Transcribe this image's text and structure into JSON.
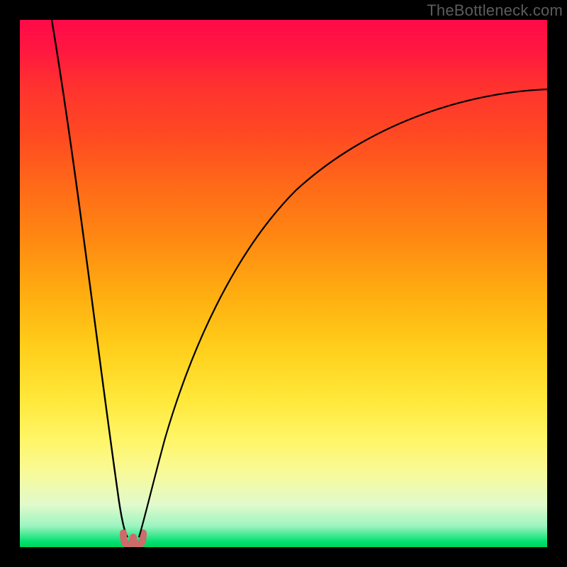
{
  "watermark": {
    "text": "TheBottleneck.com"
  },
  "colors": {
    "frame_border": "#000000",
    "curve": "#000000",
    "notch": "#cf6a6a"
  },
  "chart_data": {
    "type": "line",
    "title": "",
    "xlabel": "",
    "ylabel": "",
    "xlim": [
      0,
      100
    ],
    "ylim": [
      0,
      100
    ],
    "notch_x_pct": 20,
    "notch_width_pct": 4,
    "series": [
      {
        "name": "left-branch",
        "x": [
          6,
          8,
          10,
          12,
          14,
          16,
          18,
          19,
          20
        ],
        "y": [
          100,
          86,
          71,
          57,
          43,
          29,
          14,
          6,
          2
        ]
      },
      {
        "name": "right-branch",
        "x": [
          21,
          22,
          24,
          27,
          31,
          36,
          42,
          50,
          60,
          72,
          86,
          100
        ],
        "y": [
          2,
          8,
          20,
          34,
          46,
          56,
          64,
          71,
          76,
          80,
          83,
          85
        ]
      }
    ]
  }
}
